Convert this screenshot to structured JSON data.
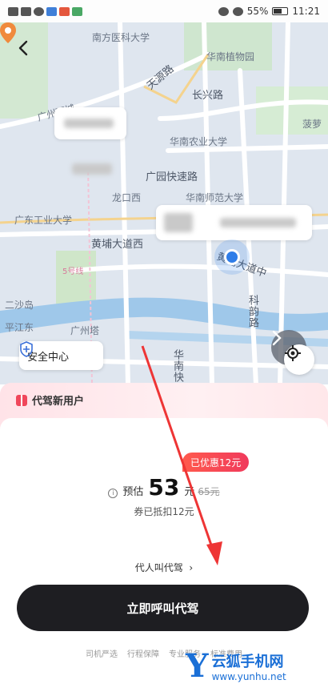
{
  "status_bar": {
    "battery": "55%",
    "time": "11:21"
  },
  "map": {
    "labels": [
      {
        "key": "hospital",
        "text": "南方医科大学"
      },
      {
        "key": "botanical",
        "text": "华南植物园"
      },
      {
        "key": "tianyuan",
        "text": "天源路"
      },
      {
        "key": "changxing",
        "text": "长兴路"
      },
      {
        "key": "scau",
        "text": "华南农业大学"
      },
      {
        "key": "guangyuan",
        "text": "广园快速路"
      },
      {
        "key": "longkou",
        "text": "龙口西"
      },
      {
        "key": "scnu",
        "text": "华南师范大学"
      },
      {
        "key": "gdut",
        "text": "广东工业大学"
      },
      {
        "key": "huangpu_w",
        "text": "黄埔大道西"
      },
      {
        "key": "huangpu_e",
        "text": "黄埔大道中"
      },
      {
        "key": "line5",
        "text": "5号线"
      },
      {
        "key": "ershajiao",
        "text": "二沙岛"
      },
      {
        "key": "canton_tower",
        "text": "广州塔"
      },
      {
        "key": "pingjiang",
        "text": "平江东"
      },
      {
        "key": "kecun",
        "text": "科韵路"
      },
      {
        "key": "huanan",
        "text": "华南快"
      },
      {
        "key": "boluo",
        "text": "菠萝"
      },
      {
        "key": "gz_rail",
        "text": "广州环城"
      }
    ]
  },
  "safety": {
    "label": "安全中心"
  },
  "promo": {
    "new_user": "代驾新用户"
  },
  "order": {
    "discount_badge": "已优惠12元",
    "est_label": "预估",
    "price": "53",
    "unit": "元",
    "original": "65元",
    "coupon_text": "券已抵扣12元",
    "proxy_call": "代人叫代驾",
    "call_button": "立即呼叫代驾"
  },
  "features": [
    "司机严选",
    "行程保障",
    "专业服务",
    "标准费用"
  ],
  "watermark": {
    "brand": "云狐手机网",
    "url": "www.yunhu.net"
  },
  "colors": {
    "accent_red": "#f03a5c",
    "button_dark": "#1e1e22",
    "location_blue": "#2f7de8",
    "brand_blue": "#1a6fd6"
  },
  "icons": [
    "back-arrow-icon",
    "shield-icon",
    "locate-icon",
    "chevron-right-icon",
    "info-icon",
    "gift-icon",
    "location-pin-icon"
  ]
}
